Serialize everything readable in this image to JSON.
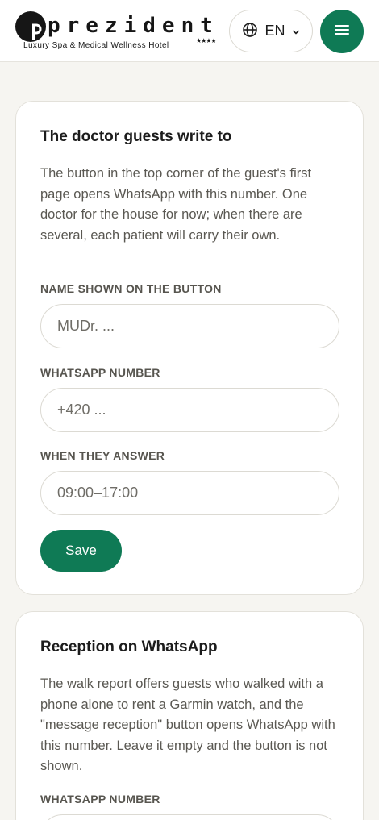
{
  "brand": {
    "wordmark": "prezident",
    "tagline": "Luxury Spa & Medical Wellness Hotel",
    "stars": "★★★★"
  },
  "header": {
    "language_label": "EN",
    "language_icon": "globe-icon",
    "dropdown_icon": "chevron-down-icon",
    "menu_icon": "menu-icon"
  },
  "colors": {
    "accent": "#0f7a55",
    "background": "#f6f5f1"
  },
  "doctor_card": {
    "title": "The doctor guests write to",
    "description": "The button in the top corner of the guest's first page opens WhatsApp with this number. One doctor for the house for now; when there are several, each patient will carry their own.",
    "name_label": "NAME SHOWN ON THE BUTTON",
    "name_placeholder": "MUDr. ...",
    "whatsapp_label": "WHATSAPP NUMBER",
    "whatsapp_placeholder": "+420 ...",
    "hours_label": "WHEN THEY ANSWER",
    "hours_placeholder": "09:00–17:00",
    "save_label": "Save"
  },
  "reception_card": {
    "title": "Reception on WhatsApp",
    "description": "The walk report offers guests who walked with a phone alone to rent a Garmin watch, and the \"message reception\" button opens WhatsApp with this number. Leave it empty and the button is not shown.",
    "whatsapp_label": "WHATSAPP NUMBER"
  }
}
